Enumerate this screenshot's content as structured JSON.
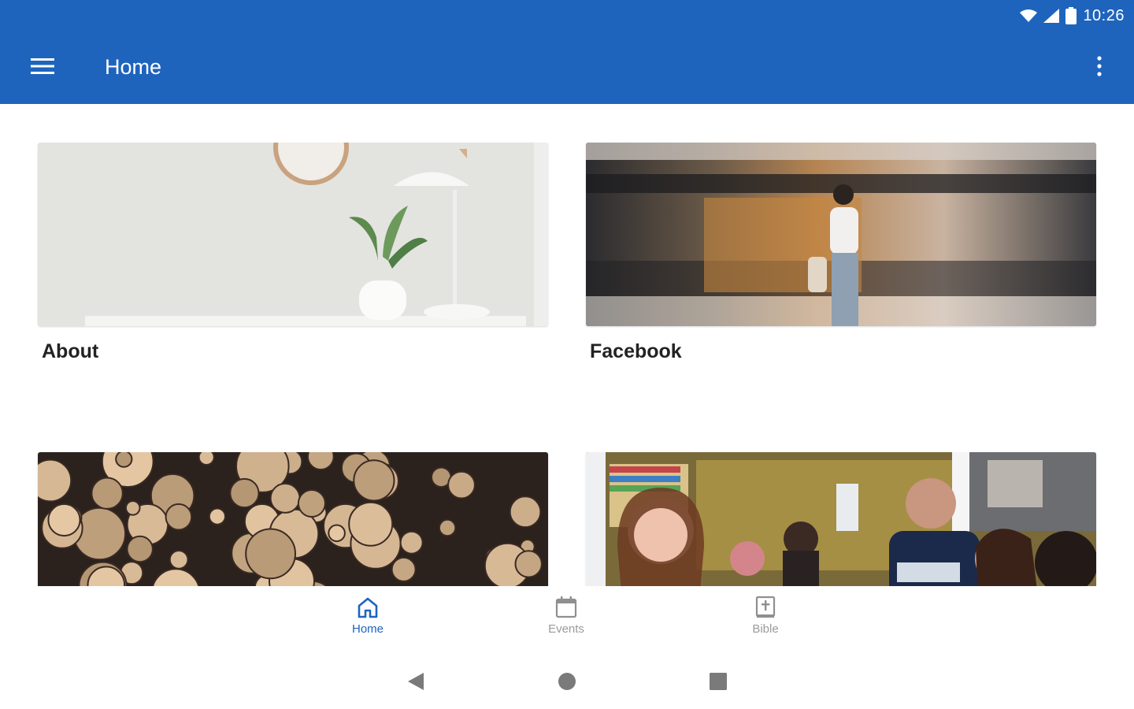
{
  "status_bar": {
    "time": "10:26"
  },
  "app_bar": {
    "title": "Home"
  },
  "cards": [
    {
      "label": "About"
    },
    {
      "label": "Facebook"
    },
    {
      "label": ""
    },
    {
      "label": ""
    }
  ],
  "bottom_nav": {
    "items": [
      {
        "label": "Home",
        "icon": "home-icon",
        "active": true
      },
      {
        "label": "Events",
        "icon": "calendar-icon",
        "active": false
      },
      {
        "label": "Bible",
        "icon": "bible-icon",
        "active": false
      }
    ]
  },
  "colors": {
    "primary": "#1e64bd",
    "inactive": "#9b9b9b",
    "text": "#222222"
  }
}
